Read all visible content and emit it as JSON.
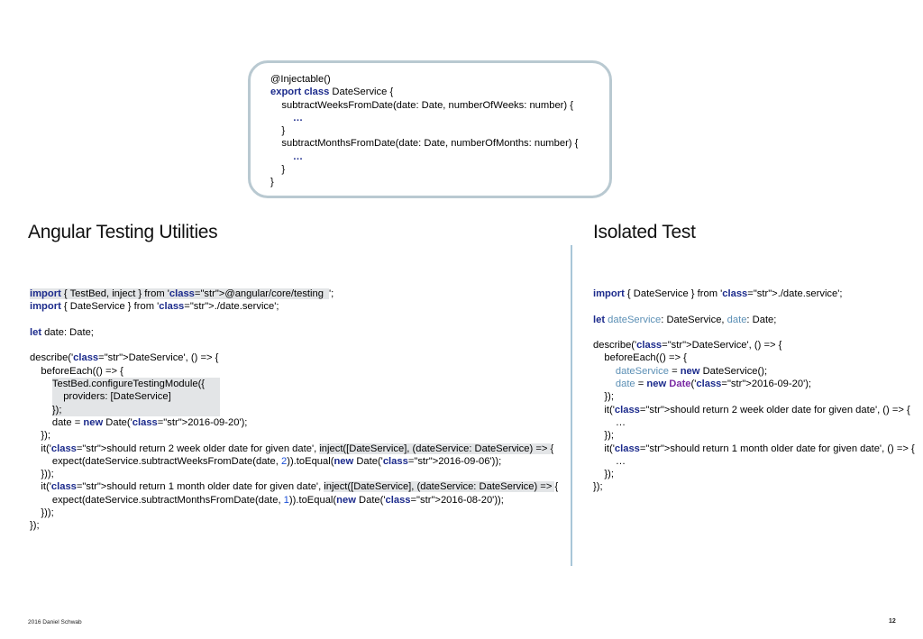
{
  "callout": {
    "lines": [
      "@Injectable()",
      "export class DateService {",
      "    subtractWeeksFromDate(date: Date, numberOfWeeks: number) {",
      "        …",
      "    }",
      "    subtractMonthsFromDate(date: Date, numberOfMonths: number) {",
      "        …",
      "    }",
      "}"
    ]
  },
  "left": {
    "title": "Angular Testing Utilities",
    "code": [
      "import { TestBed, inject } from '@angular/core/testing';",
      "import { DateService } from './date.service';",
      "",
      "let date: Date;",
      "",
      "describe('DateService', () => {",
      "    beforeEach(() => {",
      "        TestBed.configureTestingModule({",
      "            providers: [DateService]",
      "        });",
      "        date = new Date('2016-09-20');",
      "    });",
      "    it('should return 2 week older date for given date', inject([DateService], (dateService: DateService) => {",
      "        expect(dateService.subtractWeeksFromDate(date, 2)).toEqual(new Date('2016-09-06'));",
      "    }));",
      "    it('should return 1 month older date for given date', inject([DateService], (dateService: DateService) => {",
      "        expect(dateService.subtractMonthsFromDate(date, 1)).toEqual(new Date('2016-08-20'));",
      "    }));",
      "});"
    ]
  },
  "right": {
    "title": "Isolated Test",
    "code": [
      "import { DateService } from './date.service';",
      "",
      "let dateService: DateService, date: Date;",
      "",
      "describe('DateService', () => {",
      "    beforeEach(() => {",
      "        dateService = new DateService();",
      "        date = new Date('2016-09-20');",
      "    });",
      "    it('should return 2 week older date for given date', () => {",
      "        …",
      "    });",
      "    it('should return 1 month older date for given date', () => {",
      "        …",
      "    });",
      "});"
    ]
  },
  "footer": {
    "copyright": "2016 Daniel Schwab",
    "page_number": "12"
  },
  "colors": {
    "keyword": "#1c2b8c",
    "string": "#178a1e",
    "number": "#1a4fd8",
    "variable": "#5b8fb5",
    "divider": "#a9c6d8",
    "callout_border": "#b9c9d1",
    "highlight": "#e3e5e7"
  }
}
